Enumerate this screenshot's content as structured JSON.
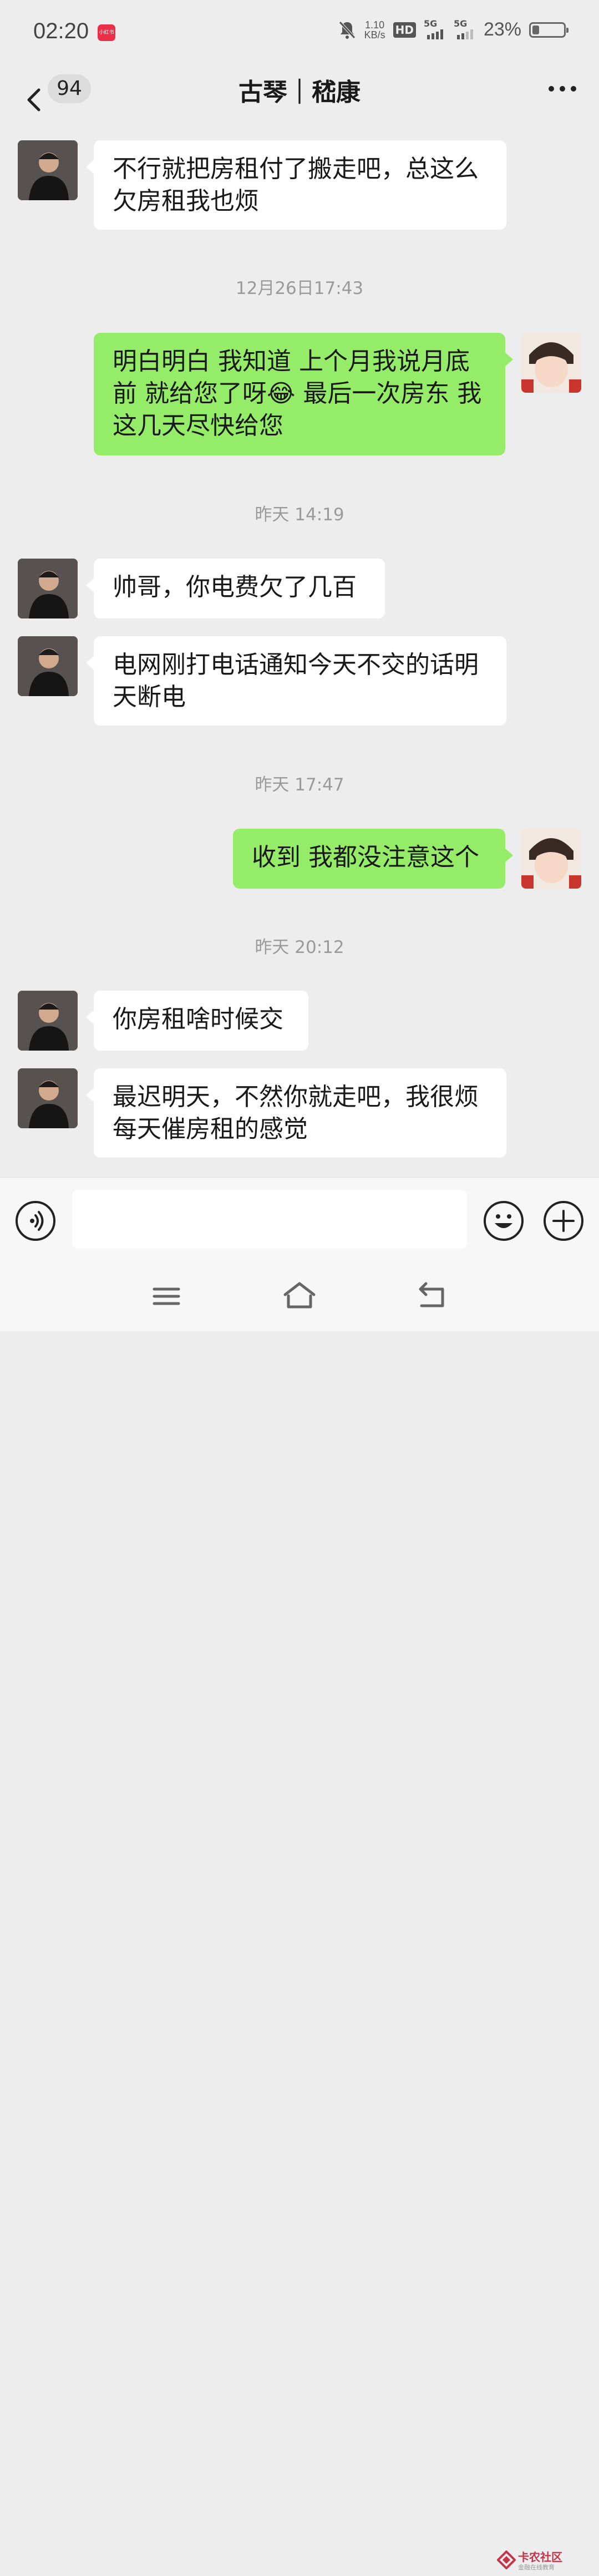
{
  "status_bar": {
    "time": "02:20",
    "app_badge": "小红书",
    "net_speed_value": "1.10",
    "net_speed_unit": "KB/s",
    "hd_label": "HD",
    "net1": "5G",
    "net2": "5G",
    "battery_percent": "23%",
    "battery_level": 0.23
  },
  "header": {
    "unread_count": "94",
    "title": "古琴｜嵇康"
  },
  "messages": [
    {
      "side": "left",
      "text": "不行就把房租付了搬走吧，总这么欠房租我也烦"
    },
    {
      "type": "time",
      "text": "12月26日17:43"
    },
    {
      "side": "right",
      "text": "明白明白 我知道 上个月我说月底前 就给您了呀😂 最后一次房东 我这几天尽快给您"
    },
    {
      "type": "time",
      "text": "昨天 14:19"
    },
    {
      "side": "left",
      "text": "帅哥，你电费欠了几百"
    },
    {
      "side": "left",
      "text": "电网刚打电话通知今天不交的话明天断电"
    },
    {
      "type": "time",
      "text": "昨天 17:47"
    },
    {
      "side": "right",
      "text": "收到 我都没注意这个"
    },
    {
      "type": "time",
      "text": "昨天 20:12"
    },
    {
      "side": "left",
      "text": "你房租啥时候交"
    },
    {
      "side": "left",
      "text": "最迟明天，不然你就走吧，我很烦每天催房租的感觉"
    }
  ],
  "watermark": {
    "name": "卡农社区",
    "tagline": "金融在线教育"
  },
  "colors": {
    "bubble_self": "#95ec69",
    "bubble_other": "#ffffff",
    "background": "#ededed"
  }
}
